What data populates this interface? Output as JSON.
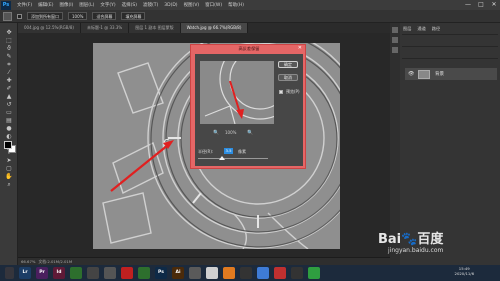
{
  "app": {
    "logo": "Ps",
    "title": "Adobe Photoshop"
  },
  "menu": [
    "文件(F)",
    "编辑(E)",
    "图像(I)",
    "图层(L)",
    "文字(Y)",
    "选择(S)",
    "滤镜(T)",
    "3D(D)",
    "视图(V)",
    "窗口(W)",
    "帮助(H)"
  ],
  "window_controls": {
    "minimize": "—",
    "maximize": "□",
    "close": "✕"
  },
  "options_bar": {
    "sample_all_layers": "添加到所有窗口",
    "zoom_value": "100%",
    "fit_screen": "适合屏幕",
    "fill_screen": "填充屏幕"
  },
  "tabs": [
    {
      "label": "004.jpg @ 12.5%(RGB/8)",
      "active": false
    },
    {
      "label": "未标题-1 @ 33.3%",
      "active": false
    },
    {
      "label": "图层 1 副本 图层蒙版",
      "active": false
    },
    {
      "label": "Watch.jpg @ 66.7%(RGB/8)",
      "active": true
    }
  ],
  "status_bar": {
    "zoom": "66.67%",
    "doc": "文档:2.01M/2.01M"
  },
  "panels": {
    "tabs": [
      "图层",
      "通道",
      "路径"
    ],
    "layer": {
      "eye": "👁",
      "name": "背景"
    }
  },
  "dialog": {
    "title": "高反差保留",
    "close": "✕",
    "ok": "确定",
    "cancel": "取消",
    "preview_label": "预览(P)",
    "zoom_minus": "🔍",
    "zoom_value": "100%",
    "zoom_plus": "🔍",
    "radius_label": "半径(R):",
    "radius_value": "3.5",
    "radius_unit": "像素"
  },
  "taskbar": [
    "Lr",
    "Pr",
    "Id",
    "Ps",
    "Ai"
  ],
  "clock": {
    "time": "15:49",
    "date": "2020/11/6"
  },
  "watermark": {
    "brand": "Bai🐾百度",
    "site": "jingyan.baidu.com"
  }
}
